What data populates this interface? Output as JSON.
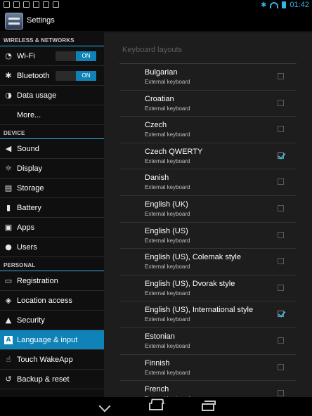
{
  "status_bar": {
    "time": "01:42",
    "icons": [
      "gallery-icon",
      "mail-icon",
      "download-icon",
      "photo-icon",
      "usb-icon",
      "wifi-notification-icon",
      "bluetooth-icon",
      "wifi-signal-icon",
      "battery-icon"
    ]
  },
  "action_bar": {
    "title": "Settings",
    "icon": "settings-app-icon"
  },
  "sidebar": {
    "sections": [
      {
        "label": "WIRELESS & NETWORKS"
      },
      {
        "label": "DEVICE"
      },
      {
        "label": "PERSONAL"
      }
    ],
    "items": [
      {
        "label": "Wi-Fi",
        "icon": "wifi-icon",
        "toggle": "ON"
      },
      {
        "label": "Bluetooth",
        "icon": "bluetooth-icon",
        "toggle": "ON"
      },
      {
        "label": "Data usage",
        "icon": "data-usage-icon"
      },
      {
        "label": "More...",
        "icon": ""
      },
      {
        "label": "Sound",
        "icon": "volume-icon"
      },
      {
        "label": "Display",
        "icon": "brightness-icon"
      },
      {
        "label": "Storage",
        "icon": "storage-icon"
      },
      {
        "label": "Battery",
        "icon": "battery-icon"
      },
      {
        "label": "Apps",
        "icon": "apps-icon"
      },
      {
        "label": "Users",
        "icon": "user-icon"
      },
      {
        "label": "Registration",
        "icon": "registration-icon"
      },
      {
        "label": "Location access",
        "icon": "location-icon"
      },
      {
        "label": "Security",
        "icon": "lock-icon"
      },
      {
        "label": "Language & input",
        "icon": "keyboard-a-icon",
        "selected": true
      },
      {
        "label": "Touch WakeApp",
        "icon": "touch-icon"
      },
      {
        "label": "Backup & reset",
        "icon": "backup-icon"
      }
    ]
  },
  "main": {
    "header": "Keyboard layouts",
    "keyboards": [
      {
        "name": "Bulgarian",
        "sub": "External keyboard",
        "checked": false
      },
      {
        "name": "Croatian",
        "sub": "External keyboard",
        "checked": false
      },
      {
        "name": "Czech",
        "sub": "External keyboard",
        "checked": false
      },
      {
        "name": "Czech QWERTY",
        "sub": "External keyboard",
        "checked": true
      },
      {
        "name": "Danish",
        "sub": "External keyboard",
        "checked": false
      },
      {
        "name": "English (UK)",
        "sub": "External keyboard",
        "checked": false
      },
      {
        "name": "English (US)",
        "sub": "External keyboard",
        "checked": false
      },
      {
        "name": "English (US), Colemak style",
        "sub": "External keyboard",
        "checked": false
      },
      {
        "name": "English (US), Dvorak style",
        "sub": "External keyboard",
        "checked": false
      },
      {
        "name": "English (US), International style",
        "sub": "External keyboard",
        "checked": true
      },
      {
        "name": "Estonian",
        "sub": "External keyboard",
        "checked": false
      },
      {
        "name": "Finnish",
        "sub": "External keyboard",
        "checked": false
      },
      {
        "name": "French",
        "sub": "External keyboard",
        "checked": false
      }
    ]
  },
  "nav_bar": {
    "buttons": [
      "back-icon",
      "home-icon",
      "recent-apps-icon"
    ]
  },
  "colors": {
    "accent": "#33b5e5",
    "selected": "#0f82b8"
  }
}
